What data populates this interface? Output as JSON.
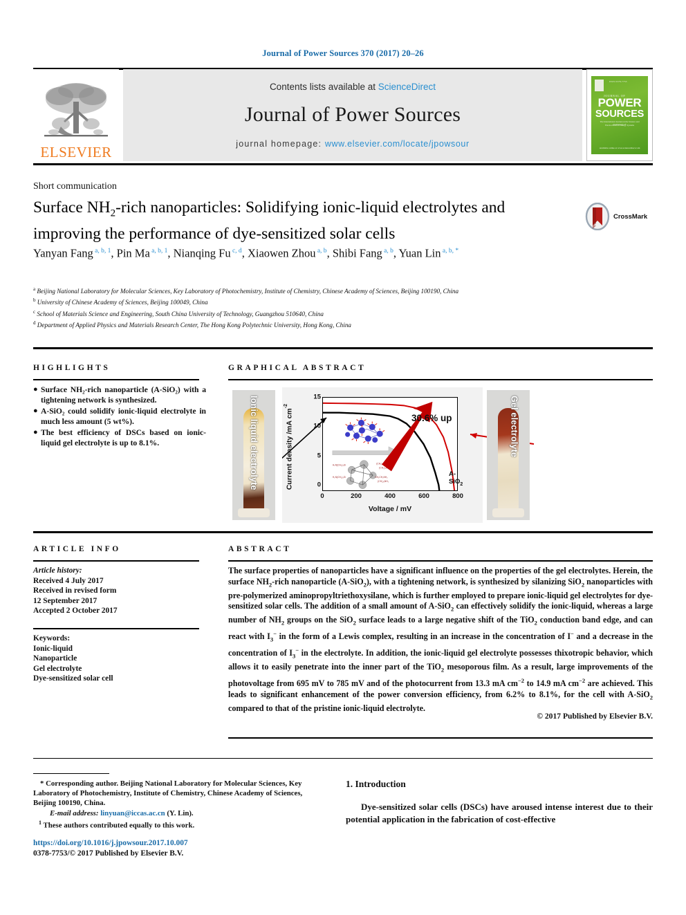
{
  "running_head": "Journal of Power Sources 370 (2017) 20–26",
  "masthead": {
    "elsevier_wordmark": "ELSEVIER",
    "contents_prefix": "Contents lists available at ",
    "contents_link": "ScienceDirect",
    "journal_title": "Journal of Power Sources",
    "homepage_prefix": "journal homepage: ",
    "homepage_url": "www.elsevier.com/locate/jpowsour",
    "cover": {
      "word_power": "POWER",
      "word_sources": "SOURCES",
      "top_small": "ISSN 0378-7753",
      "sub_small": "JOURNAL OF",
      "foot1": "The International Journal on the Science and Technology of",
      "foot2": "Electrochemical Energy Systems",
      "bottom": "Available online at\nwww.sciencedirect.com"
    }
  },
  "article": {
    "section_type": "Short communication",
    "title_line1_a": "Surface NH",
    "title_line1_sub": "2",
    "title_line1_b": "-rich nanoparticles: Solidifying ionic-liquid electrolytes",
    "title_line2": "and improving the performance of dye-sensitized solar cells",
    "crossmark_label": "CrossMark",
    "authors": [
      {
        "name": "Yanyan Fang",
        "sup": "a, b, 1",
        "sep": ", "
      },
      {
        "name": "Pin Ma",
        "sup": "a, b, 1",
        "sep": ", "
      },
      {
        "name": "Nianqing Fu",
        "sup": "c, d",
        "sep": ", "
      },
      {
        "name": "Xiaowen Zhou",
        "sup": "a, b",
        "sep": ", "
      },
      {
        "name": "Shibi Fang",
        "sup": "a, b",
        "sep": ", "
      },
      {
        "name": "Yuan Lin",
        "sup": "a, b, *",
        "sep": ""
      }
    ],
    "affiliations": [
      {
        "mark": "a",
        "text": "Beijing National Laboratory for Molecular Sciences, Key Laboratory of Photochemistry, Institute of Chemistry, Chinese Academy of Sciences, Beijing 100190, China"
      },
      {
        "mark": "b",
        "text": "University of Chinese Academy of Sciences, Beijing 100049, China"
      },
      {
        "mark": "c",
        "text": "School of Materials Science and Engineering, South China University of Technology, Guangzhou 510640, China"
      },
      {
        "mark": "d",
        "text": "Department of Applied Physics and Materials Research Center, The Hong Kong Polytechnic University, Hong Kong, China"
      }
    ]
  },
  "highlights": {
    "heading": "HIGHLIGHTS",
    "items": [
      "Surface NH₂-rich nanoparticle (A-SiO₂) with a tightening network is synthesized.",
      "A-SiO₂ could solidify ionic-liquid electrolyte in much less amount (5 wt%).",
      "The best efficiency of DSCs based on ionic-liquid gel electrolyte is up to 8.1%."
    ]
  },
  "graphical_abstract": {
    "heading": "GRAPHICAL ABSTRACT",
    "left_image_label": "Ionic liquid electrolyte",
    "right_image_label": "Gel electrolyte"
  },
  "chart_data": {
    "type": "line",
    "title": "",
    "xlabel": "Voltage / mV",
    "ylabel": "Current density /mA cm⁻²",
    "xlim": [
      0,
      800
    ],
    "ylim": [
      0,
      16
    ],
    "xticks": [
      0,
      200,
      400,
      600,
      800
    ],
    "yticks": [
      0,
      5,
      10,
      15
    ],
    "grid": false,
    "legend_position": "none",
    "annotations": [
      {
        "text": "30.6% up",
        "color": "#111111"
      },
      {
        "text": "A-SiO2",
        "color": "#111111"
      }
    ],
    "series": [
      {
        "name": "Ionic liquid electrolyte (pristine)",
        "color": "#000000",
        "jsc": 13.3,
        "voc": 695,
        "x": [
          0,
          100,
          200,
          300,
          400,
          450,
          500,
          550,
          600,
          640,
          670,
          690,
          695
        ],
        "y": [
          13.3,
          13.3,
          13.28,
          13.25,
          13.1,
          12.9,
          12.5,
          11.7,
          10.2,
          8.2,
          5.4,
          2.0,
          0
        ]
      },
      {
        "name": "Gel electrolyte with A-SiO2",
        "color": "#d00000",
        "jsc": 14.9,
        "voc": 785,
        "x": [
          0,
          100,
          200,
          300,
          400,
          480,
          550,
          620,
          680,
          720,
          750,
          775,
          785
        ],
        "y": [
          14.9,
          14.88,
          14.85,
          14.8,
          14.72,
          14.6,
          14.2,
          13.2,
          11.2,
          8.8,
          5.6,
          1.8,
          0
        ]
      }
    ]
  },
  "article_info": {
    "heading": "ARTICLE INFO",
    "history_label": "Article history:",
    "history_lines": [
      "Received 4 July 2017",
      "Received in revised form",
      "12 September 2017",
      "Accepted 2 October 2017"
    ],
    "keywords_label": "Keywords:",
    "keywords": [
      "Ionic-liquid",
      "Nanoparticle",
      "Gel electrolyte",
      "Dye-sensitized solar cell"
    ]
  },
  "abstract": {
    "heading": "ABSTRACT",
    "paragraph_parts": [
      {
        "t": "The surface properties of nanoparticles have a significant influence on the properties of the gel electrolytes. Herein, the surface NH"
      },
      {
        "sub": "2"
      },
      {
        "t": "-rich nanoparticle (A-SiO"
      },
      {
        "sub": "2"
      },
      {
        "t": "), with a tightening network, is synthesized by silanizing SiO"
      },
      {
        "sub": "2"
      },
      {
        "t": " nanoparticles with pre-polymerized aminopropyltriethoxysilane, which is further employed to prepare ionic-liquid gel electrolytes for dye-sensitized solar cells. The addition of a small amount of A-SiO"
      },
      {
        "sub": "2"
      },
      {
        "t": " can effectively solidify the ionic-liquid, whereas a large number of NH"
      },
      {
        "sub": "2"
      },
      {
        "t": " groups on the SiO"
      },
      {
        "sub": "2"
      },
      {
        "t": " surface leads to a large negative shift of the TiO"
      },
      {
        "sub": "2"
      },
      {
        "t": " conduction band edge, and can react with I"
      },
      {
        "sub": "3"
      },
      {
        "sup": "−"
      },
      {
        "t": " in the form of a Lewis complex, resulting in an increase in the concentration of I"
      },
      {
        "sup": "−"
      },
      {
        "t": " and a decrease in the concentration of I"
      },
      {
        "sub": "3"
      },
      {
        "sup": "−"
      },
      {
        "t": " in the electrolyte. In addition, the ionic-liquid gel electrolyte possesses thixotropic behavior, which allows it to easily penetrate into the inner part of the TiO"
      },
      {
        "sub": "2"
      },
      {
        "t": " mesoporous film. As a result, large improvements of the photovoltage from 695 mV to 785 mV and of the photocurrent from 13.3 mA cm"
      },
      {
        "sup": "−2"
      },
      {
        "t": " to 14.9 mA cm"
      },
      {
        "sup": "−2"
      },
      {
        "t": " are achieved. This leads to significant enhancement of the power conversion efficiency, from 6.2% to 8.1%, for the cell with A-SiO"
      },
      {
        "sub": "2"
      },
      {
        "t": " compared to that of the pristine ionic-liquid electrolyte."
      }
    ],
    "copyright": "© 2017 Published by Elsevier B.V."
  },
  "footnotes": {
    "corresponding": "* Corresponding author. Beijing National Laboratory for Molecular Sciences, Key Laboratory of Photochemistry, Institute of Chemistry, Chinese Academy of Sciences, Beijing 100190, China.",
    "email_label": "E-mail address:",
    "email": "linyuan@iccas.ac.cn",
    "email_suffix": "(Y. Lin).",
    "equal_marker": "1",
    "equal_contrib": "These authors contributed equally to this work."
  },
  "doi_block": {
    "doi": "https://doi.org/10.1016/j.jpowsour.2017.10.007",
    "issn_line": "0378-7753/© 2017 Published by Elsevier B.V."
  },
  "introduction": {
    "heading": "1. Introduction",
    "paragraph": "Dye-sensitized solar cells (DSCs) have aroused intense interest due to their potential application in the fabrication of cost-effective"
  },
  "colors": {
    "link_blue": "#1a6ca8",
    "sciencedirect_blue": "#2a8fd0",
    "elsevier_orange": "#ef7b20",
    "cover_green": "#6cae2a",
    "curve_red": "#d00000",
    "curve_black": "#000000",
    "arrow_red": "#c00000",
    "masthead_gray": "#e8e8e8"
  }
}
